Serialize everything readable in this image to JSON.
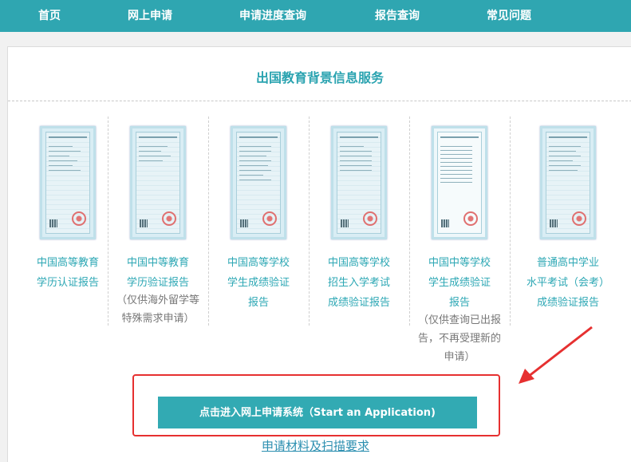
{
  "nav": {
    "items": [
      {
        "label": "首页"
      },
      {
        "label": "网上申请"
      },
      {
        "label": "申请进度查询"
      },
      {
        "label": "报告查询"
      },
      {
        "label": "常见问题"
      }
    ]
  },
  "main": {
    "title": "出国教育背景信息服务",
    "cards": [
      {
        "label": "中国高等教育\n学历认证报告",
        "note": ""
      },
      {
        "label": "中国中等教育\n学历验证报告",
        "note": "（仅供海外留学等\n特殊需求申请）"
      },
      {
        "label": "中国高等学校\n学生成绩验证\n报告",
        "note": ""
      },
      {
        "label": "中国高等学校\n招生入学考试\n成绩验证报告",
        "note": ""
      },
      {
        "label": "中国中等学校\n学生成绩验证\n报告",
        "note": "（仅供查询已出报\n告，不再受理新的\n申请）"
      },
      {
        "label": "普通高中学业\n水平考试（会考）\n成绩验证报告",
        "note": ""
      }
    ],
    "apply_button": "点击进入网上申请系统（Start an Application)",
    "requirements_link": "申请材料及扫描要求"
  },
  "colors": {
    "nav_bg": "#2fa6b1",
    "accent": "#2aa3b0",
    "highlight": "#e63030"
  }
}
